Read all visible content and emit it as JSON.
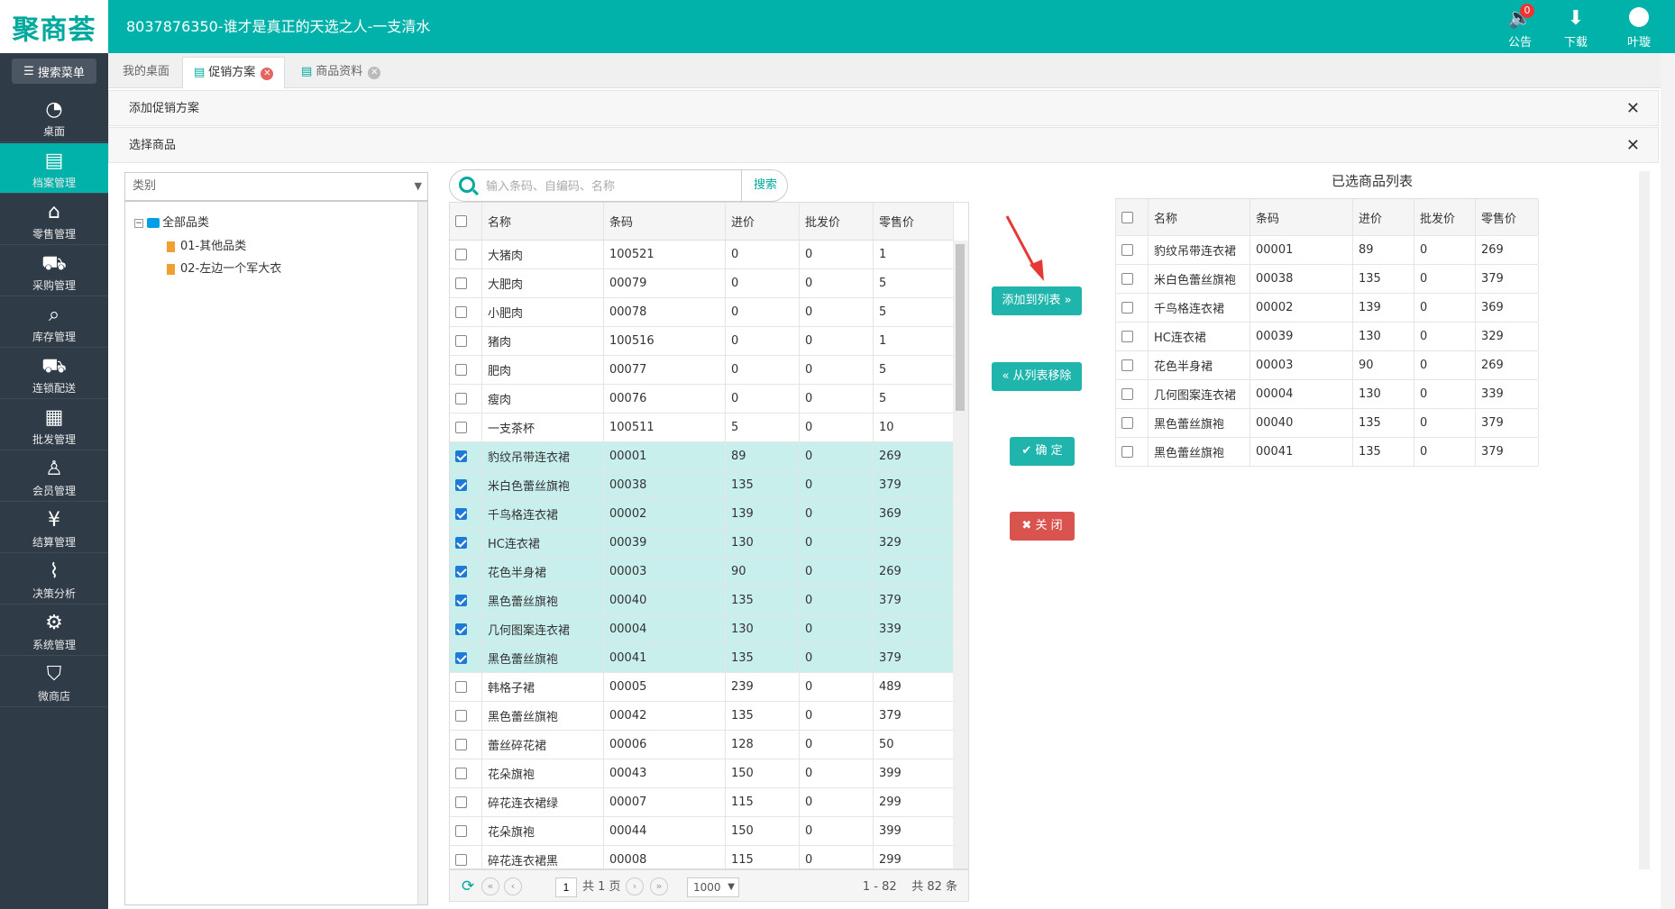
{
  "app": {
    "logo": "聚商荟",
    "title": "8037876350-谁才是真正的天选之人-一支清水"
  },
  "topbar": {
    "notice_label": "公告",
    "notice_count": "0",
    "download_label": "下载",
    "user_label": "叶璇"
  },
  "sidebar": {
    "search_label": "搜索菜单",
    "items": [
      {
        "label": "桌面",
        "icon": "dashboard-icon"
      },
      {
        "label": "档案管理",
        "icon": "archive-icon",
        "active": true
      },
      {
        "label": "零售管理",
        "icon": "store-icon"
      },
      {
        "label": "采购管理",
        "icon": "cart-icon"
      },
      {
        "label": "库存管理",
        "icon": "inventory-icon"
      },
      {
        "label": "连锁配送",
        "icon": "truck-icon"
      },
      {
        "label": "批发管理",
        "icon": "wholesale-icon"
      },
      {
        "label": "会员管理",
        "icon": "member-icon"
      },
      {
        "label": "结算管理",
        "icon": "settlement-icon"
      },
      {
        "label": "决策分析",
        "icon": "chart-icon"
      },
      {
        "label": "系统管理",
        "icon": "gear-icon"
      },
      {
        "label": "微商店",
        "icon": "shop-icon"
      }
    ]
  },
  "tabs": [
    {
      "label": "我的桌面"
    },
    {
      "label": "促销方案",
      "active": true
    },
    {
      "label": "商品资料"
    }
  ],
  "panels": {
    "add_promotion": "添加促销方案",
    "select_goods": "选择商品"
  },
  "category": {
    "placeholder": "类别"
  },
  "tree": {
    "root": "全部品类",
    "children": [
      "01-其他品类",
      "02-左边一个军大衣"
    ]
  },
  "search": {
    "placeholder": "输入条码、自编码、名称",
    "button": "搜索"
  },
  "grid": {
    "columns": [
      "名称",
      "条码",
      "进价",
      "批发价",
      "零售价"
    ],
    "rows": [
      {
        "name": "大猪肉",
        "code": "100521",
        "cost": "0",
        "wholesale": "0",
        "retail": "1",
        "checked": false
      },
      {
        "name": "大肥肉",
        "code": "00079",
        "cost": "0",
        "wholesale": "0",
        "retail": "5",
        "checked": false
      },
      {
        "name": "小肥肉",
        "code": "00078",
        "cost": "0",
        "wholesale": "0",
        "retail": "5",
        "checked": false
      },
      {
        "name": "猪肉",
        "code": "100516",
        "cost": "0",
        "wholesale": "0",
        "retail": "1",
        "checked": false
      },
      {
        "name": "肥肉",
        "code": "00077",
        "cost": "0",
        "wholesale": "0",
        "retail": "5",
        "checked": false
      },
      {
        "name": "瘦肉",
        "code": "00076",
        "cost": "0",
        "wholesale": "0",
        "retail": "5",
        "checked": false
      },
      {
        "name": "一支茶杯",
        "code": "100511",
        "cost": "5",
        "wholesale": "0",
        "retail": "10",
        "checked": false
      },
      {
        "name": "豹纹吊带连衣裙",
        "code": "00001",
        "cost": "89",
        "wholesale": "0",
        "retail": "269",
        "checked": true
      },
      {
        "name": "米白色蕾丝旗袍",
        "code": "00038",
        "cost": "135",
        "wholesale": "0",
        "retail": "379",
        "checked": true
      },
      {
        "name": "千鸟格连衣裙",
        "code": "00002",
        "cost": "139",
        "wholesale": "0",
        "retail": "369",
        "checked": true
      },
      {
        "name": "HC连衣裙",
        "code": "00039",
        "cost": "130",
        "wholesale": "0",
        "retail": "329",
        "checked": true
      },
      {
        "name": "花色半身裙",
        "code": "00003",
        "cost": "90",
        "wholesale": "0",
        "retail": "269",
        "checked": true
      },
      {
        "name": "黑色蕾丝旗袍",
        "code": "00040",
        "cost": "135",
        "wholesale": "0",
        "retail": "379",
        "checked": true
      },
      {
        "name": "几何图案连衣裙",
        "code": "00004",
        "cost": "130",
        "wholesale": "0",
        "retail": "339",
        "checked": true
      },
      {
        "name": "黑色蕾丝旗袍",
        "code": "00041",
        "cost": "135",
        "wholesale": "0",
        "retail": "379",
        "checked": true
      },
      {
        "name": "韩格子裙",
        "code": "00005",
        "cost": "239",
        "wholesale": "0",
        "retail": "489",
        "checked": false
      },
      {
        "name": "黑色蕾丝旗袍",
        "code": "00042",
        "cost": "135",
        "wholesale": "0",
        "retail": "379",
        "checked": false
      },
      {
        "name": "蕾丝碎花裙",
        "code": "00006",
        "cost": "128",
        "wholesale": "0",
        "retail": "50",
        "checked": false
      },
      {
        "name": "花朵旗袍",
        "code": "00043",
        "cost": "150",
        "wholesale": "0",
        "retail": "399",
        "checked": false
      },
      {
        "name": "碎花连衣裙绿",
        "code": "00007",
        "cost": "115",
        "wholesale": "0",
        "retail": "299",
        "checked": false
      },
      {
        "name": "花朵旗袍",
        "code": "00044",
        "cost": "150",
        "wholesale": "0",
        "retail": "399",
        "checked": false
      },
      {
        "name": "碎花连衣裙黑",
        "code": "00008",
        "cost": "115",
        "wholesale": "0",
        "retail": "299",
        "checked": false
      }
    ]
  },
  "pager": {
    "page": "1",
    "total_pages": "共 1 页",
    "page_size": "1000",
    "info": "1 - 82    共 82 条"
  },
  "actions": {
    "add": "添加到列表",
    "remove": "从列表移除",
    "confirm": "确 定",
    "close": "关 闭"
  },
  "selected": {
    "title": "已选商品列表",
    "columns": [
      "名称",
      "条码",
      "进价",
      "批发价",
      "零售价"
    ],
    "rows": [
      {
        "name": "豹纹吊带连衣裙",
        "code": "00001",
        "cost": "89",
        "wholesale": "0",
        "retail": "269"
      },
      {
        "name": "米白色蕾丝旗袍",
        "code": "00038",
        "cost": "135",
        "wholesale": "0",
        "retail": "379"
      },
      {
        "name": "千鸟格连衣裙",
        "code": "00002",
        "cost": "139",
        "wholesale": "0",
        "retail": "369"
      },
      {
        "name": "HC连衣裙",
        "code": "00039",
        "cost": "130",
        "wholesale": "0",
        "retail": "329"
      },
      {
        "name": "花色半身裙",
        "code": "00003",
        "cost": "90",
        "wholesale": "0",
        "retail": "269"
      },
      {
        "name": "几何图案连衣裙",
        "code": "00004",
        "cost": "130",
        "wholesale": "0",
        "retail": "339"
      },
      {
        "name": "黑色蕾丝旗袍",
        "code": "00040",
        "cost": "135",
        "wholesale": "0",
        "retail": "379"
      },
      {
        "name": "黑色蕾丝旗袍",
        "code": "00041",
        "cost": "135",
        "wholesale": "0",
        "retail": "379"
      }
    ]
  },
  "colors": {
    "primary": "#00b2a9",
    "sidebar": "#2f3b47",
    "danger": "#d9534f",
    "selected_row": "#c9efed"
  }
}
